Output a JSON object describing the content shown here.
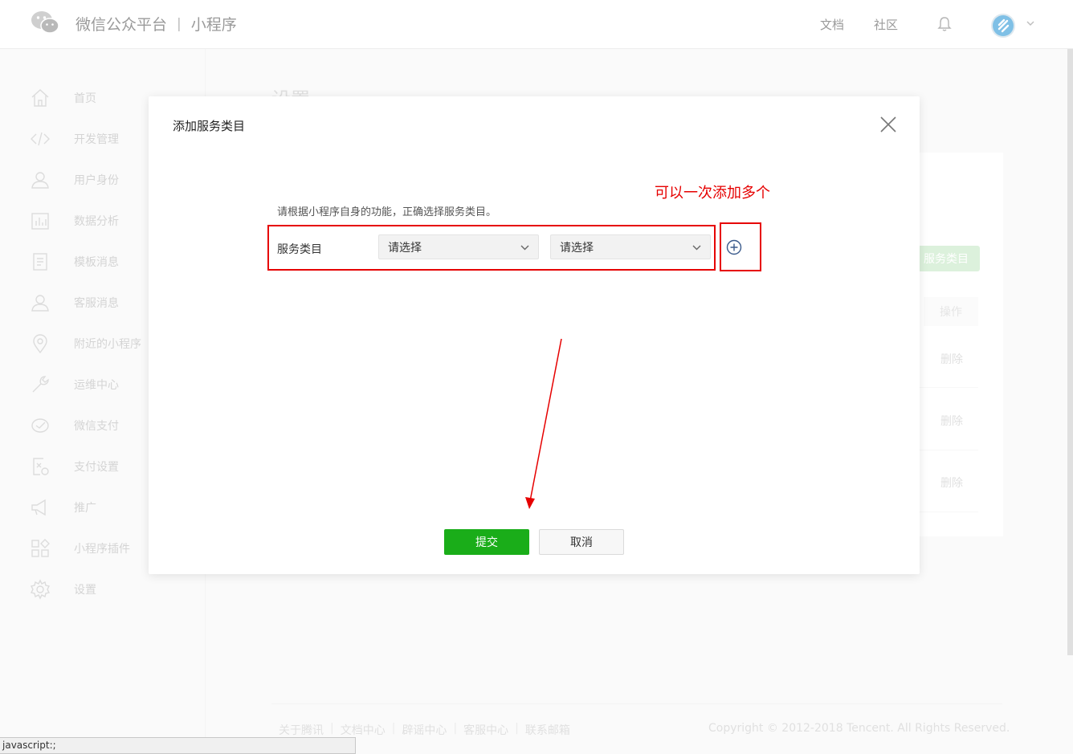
{
  "header": {
    "brand_main": "微信公众平台",
    "brand_sep": "|",
    "brand_sub": "小程序",
    "links": [
      "文档",
      "社区"
    ]
  },
  "sidebar": {
    "items": [
      {
        "label": "首页",
        "icon": "home-icon"
      },
      {
        "label": "开发管理",
        "icon": "code-icon"
      },
      {
        "label": "用户身份",
        "icon": "user-icon"
      },
      {
        "label": "数据分析",
        "icon": "chart-icon"
      },
      {
        "label": "模板消息",
        "icon": "document-icon"
      },
      {
        "label": "客服消息",
        "icon": "service-icon"
      },
      {
        "label": "附近的小程序",
        "icon": "location-icon"
      },
      {
        "label": "运维中心",
        "icon": "wrench-icon"
      },
      {
        "label": "微信支付",
        "icon": "pay-icon"
      },
      {
        "label": "支付设置",
        "icon": "pay-settings-icon"
      },
      {
        "label": "推广",
        "icon": "megaphone-icon"
      },
      {
        "label": "小程序插件",
        "icon": "plugin-icon"
      },
      {
        "label": "设置",
        "icon": "gear-icon"
      }
    ]
  },
  "background": {
    "page_title": "设置",
    "add_button": "服务类目",
    "op_header": "操作",
    "delete_label": "删除"
  },
  "modal": {
    "title": "添加服务类目",
    "description": "请根据小程序自身的功能，正确选择服务类目。",
    "row_label": "服务类目",
    "select_1": "请选择",
    "select_2": "请选择",
    "submit": "提交",
    "cancel": "取消"
  },
  "annotation": {
    "text": "可以一次添加多个",
    "color": "#e60000"
  },
  "footer": {
    "links": [
      "关于腾讯",
      "文档中心",
      "辟谣中心",
      "客服中心",
      "联系邮箱"
    ],
    "copyright": "Copyright © 2012-2018 Tencent. All Rights Reserved."
  },
  "statusbar": {
    "text": "javascript:;"
  },
  "colors": {
    "primary_green": "#1aad19",
    "annotation_red": "#e60000"
  }
}
